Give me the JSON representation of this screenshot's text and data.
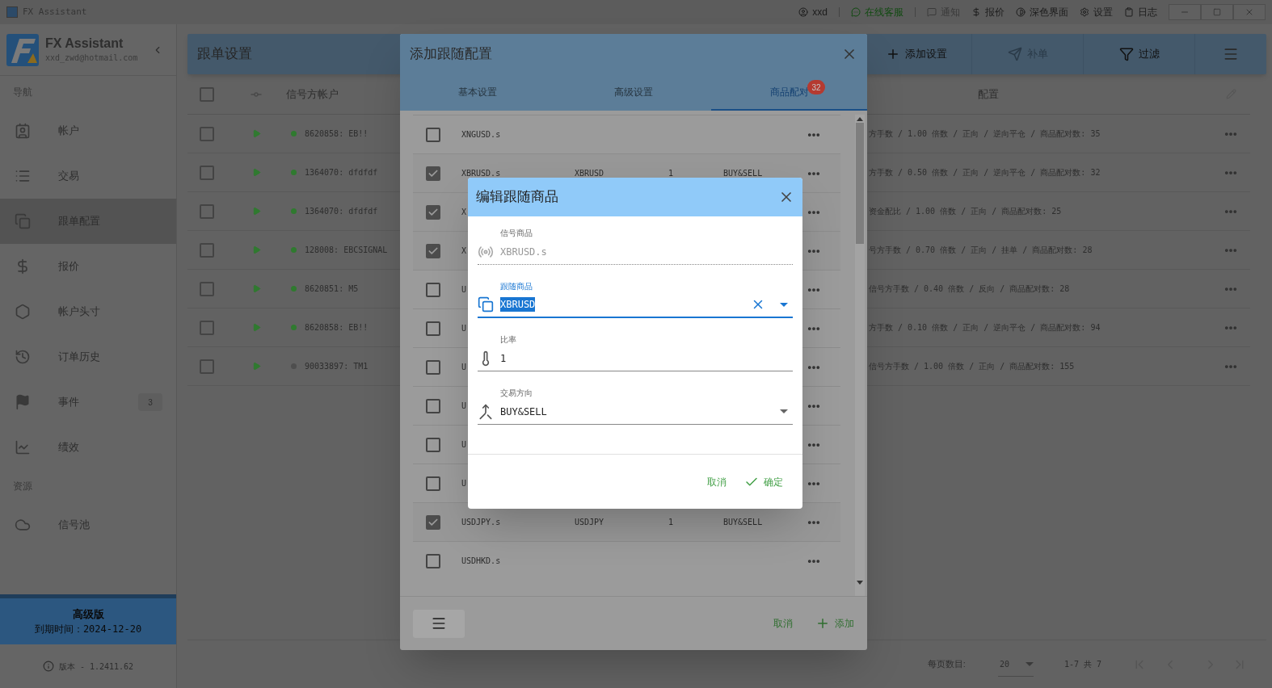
{
  "titlebar": {
    "app_title": "FX Assistant",
    "items": [
      {
        "kind": "user",
        "label": "xxd",
        "disabled": false
      },
      {
        "kind": "support",
        "label": "在线客服",
        "disabled": false
      },
      {
        "kind": "notify",
        "label": "通知",
        "disabled": true
      },
      {
        "kind": "quote",
        "label": "报价",
        "disabled": false
      },
      {
        "kind": "theme",
        "label": "深色界面",
        "disabled": false
      },
      {
        "kind": "settings",
        "label": "设置",
        "disabled": false
      },
      {
        "kind": "log",
        "label": "日志",
        "disabled": false
      }
    ]
  },
  "sidebar": {
    "brand": {
      "name": "FX Assistant",
      "email": "xxd_zwd@hotmail.com"
    },
    "sections": [
      {
        "heading": "导航",
        "items": [
          {
            "kind": "accounts",
            "label": "帐户",
            "selected": false
          },
          {
            "kind": "trades",
            "label": "交易",
            "selected": false
          },
          {
            "kind": "copy",
            "label": "跟单配置",
            "selected": true
          },
          {
            "kind": "quote",
            "label": "报价",
            "selected": false
          },
          {
            "kind": "positions",
            "label": "帐户头寸",
            "selected": false
          },
          {
            "kind": "history",
            "label": "订单历史",
            "selected": false
          },
          {
            "kind": "events",
            "label": "事件",
            "selected": false,
            "badge": "3"
          },
          {
            "kind": "performance",
            "label": "绩效",
            "selected": false
          }
        ]
      },
      {
        "heading": "资源",
        "items": [
          {
            "kind": "signals",
            "label": "信号池",
            "selected": false
          }
        ]
      }
    ],
    "plan": {
      "name": "高级版",
      "expiry": "到期时间：2024-12-20"
    },
    "version": "版本 - 1.2411.62"
  },
  "main": {
    "title": "跟单设置",
    "actions": [
      {
        "kind": "add",
        "label": "添加设置",
        "disabled": false
      },
      {
        "kind": "send",
        "label": "补单",
        "disabled": true
      },
      {
        "kind": "filter",
        "label": "过滤",
        "disabled": false
      }
    ],
    "table": {
      "columns": [
        "信号方帐户",
        "配置"
      ],
      "header_checked": false,
      "rows": [
        {
          "checked": false,
          "online": true,
          "account": "8620858: EB!!",
          "config": "方手数 / 1.00 倍数 / 正向 / 逆向平仓 / 商品配对数: 35"
        },
        {
          "checked": false,
          "online": true,
          "account": "1364070: dfdfdf",
          "config": "方手数 / 0.50 倍数 / 正向 / 逆向平仓 / 商品配对数: 32"
        },
        {
          "checked": false,
          "online": true,
          "account": "1364070: dfdfdf",
          "config": "资金配比 / 1.00 倍数 / 正向 / 商品配对数: 25"
        },
        {
          "checked": false,
          "online": true,
          "account": "128008: EBCSIGNAL",
          "config": "号方手数 / 0.70 倍数 / 正向 / 挂单 / 商品配对数: 28"
        },
        {
          "checked": false,
          "online": true,
          "account": "8620851: M5",
          "config": "信号方手数 / 0.40 倍数 / 反向 / 商品配对数: 28"
        },
        {
          "checked": false,
          "online": true,
          "account": "8620858: EB!!",
          "config": "方手数 / 0.10 倍数 / 正向 / 逆向平仓 / 商品配对数: 94"
        },
        {
          "checked": false,
          "online": false,
          "account": "90033897: TM1",
          "config": "信号方手数 / 1.00 倍数 / 正向 / 商品配对数: 155"
        }
      ]
    },
    "pagination": {
      "per_page_label": "每页数目:",
      "per_page": "20",
      "range": "1-7 共 7"
    }
  },
  "dialog": {
    "title": "添加跟随配置",
    "tabs": [
      {
        "label": "基本设置",
        "selected": false
      },
      {
        "label": "高级设置",
        "selected": false
      },
      {
        "label": "商品配对",
        "selected": true,
        "badge": "32"
      }
    ],
    "rows": [
      {
        "checked": false,
        "symbol": "XNGUSD.s"
      },
      {
        "checked": true,
        "symbol": "XBRUSD.s",
        "follow": "XBRUSD",
        "ratio": "1",
        "direction": "BUY&SELL"
      },
      {
        "checked": true,
        "symbol": "X"
      },
      {
        "checked": true,
        "symbol": "X"
      },
      {
        "checked": false,
        "symbol": "U"
      },
      {
        "checked": false,
        "symbol": "U"
      },
      {
        "checked": false,
        "symbol": "U"
      },
      {
        "checked": false,
        "symbol": "U"
      },
      {
        "checked": false,
        "symbol": "U"
      },
      {
        "checked": false,
        "symbol": "U"
      },
      {
        "checked": true,
        "symbol": "USDJPY.s",
        "follow": "USDJPY",
        "ratio": "1",
        "direction": "BUY&SELL"
      },
      {
        "checked": false,
        "symbol": "USDHKD.s"
      }
    ],
    "cancel": "取消",
    "add": "添加"
  },
  "edit_dialog": {
    "title": "编辑跟随商品",
    "fields": [
      {
        "kind": "readonly",
        "label": "信号商品",
        "value": "XBRUSD.s",
        "focused": false
      },
      {
        "kind": "combo",
        "label": "跟随商品",
        "value": "XBRUSD",
        "focused": true
      },
      {
        "kind": "text",
        "label": "比率",
        "value": "1",
        "focused": false
      },
      {
        "kind": "select",
        "label": "交易方向",
        "value": "BUY&SELL",
        "focused": false
      }
    ],
    "cancel": "取消",
    "confirm": "确定"
  }
}
